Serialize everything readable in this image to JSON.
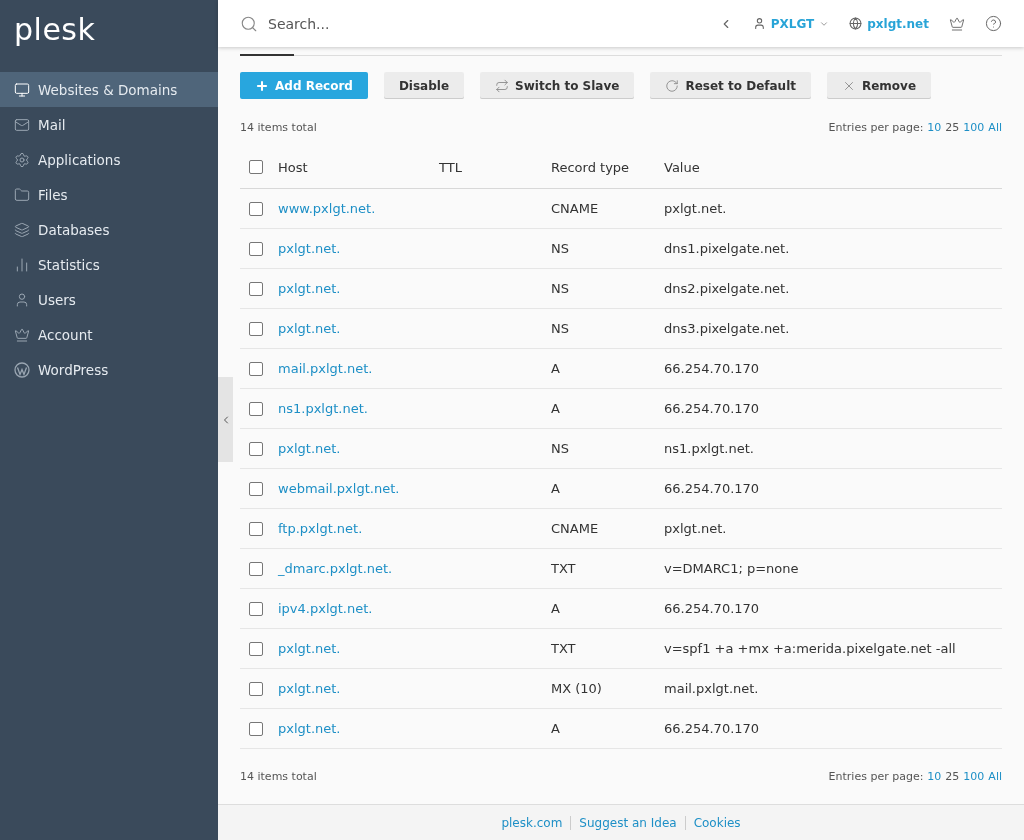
{
  "sidebar": {
    "logo": "plesk",
    "items": [
      {
        "label": "Websites & Domains",
        "selected": true
      },
      {
        "label": "Mail",
        "selected": false
      },
      {
        "label": "Applications",
        "selected": false
      },
      {
        "label": "Files",
        "selected": false
      },
      {
        "label": "Databases",
        "selected": false
      },
      {
        "label": "Statistics",
        "selected": false
      },
      {
        "label": "Users",
        "selected": false
      },
      {
        "label": "Account",
        "selected": false
      },
      {
        "label": "WordPress",
        "selected": false
      }
    ]
  },
  "topbar": {
    "search_placeholder": "Search...",
    "user": "PXLGT",
    "domain": "pxlgt.net"
  },
  "toolbar": [
    {
      "label": "Add Record",
      "kind": "primary"
    },
    {
      "label": "Disable",
      "kind": "plain"
    },
    {
      "label": "Switch to Slave",
      "kind": "plain"
    },
    {
      "label": "Reset to Default",
      "kind": "plain"
    },
    {
      "label": "Remove",
      "kind": "plain"
    }
  ],
  "summary_top": {
    "total": "14 items total",
    "entries_label": "Entries per page:",
    "options": [
      {
        "label": "10",
        "selected": false
      },
      {
        "label": "25",
        "selected": true
      },
      {
        "label": "100",
        "selected": false
      },
      {
        "label": "All",
        "selected": false
      }
    ]
  },
  "table": {
    "select_all_checked": false,
    "columns": [
      "Host",
      "TTL",
      "Record type",
      "Value"
    ],
    "rows": [
      {
        "host": "www.pxlgt.net.",
        "ttl": "",
        "type": "CNAME",
        "value": "pxlgt.net.",
        "checked": false
      },
      {
        "host": "pxlgt.net.",
        "ttl": "",
        "type": "NS",
        "value": "dns1.pixelgate.net.",
        "checked": false
      },
      {
        "host": "pxlgt.net.",
        "ttl": "",
        "type": "NS",
        "value": "dns2.pixelgate.net.",
        "checked": false
      },
      {
        "host": "pxlgt.net.",
        "ttl": "",
        "type": "NS",
        "value": "dns3.pixelgate.net.",
        "checked": false
      },
      {
        "host": "mail.pxlgt.net.",
        "ttl": "",
        "type": "A",
        "value": "66.254.70.170",
        "checked": false
      },
      {
        "host": "ns1.pxlgt.net.",
        "ttl": "",
        "type": "A",
        "value": "66.254.70.170",
        "checked": false
      },
      {
        "host": "pxlgt.net.",
        "ttl": "",
        "type": "NS",
        "value": "ns1.pxlgt.net.",
        "checked": false
      },
      {
        "host": "webmail.pxlgt.net.",
        "ttl": "",
        "type": "A",
        "value": "66.254.70.170",
        "checked": false
      },
      {
        "host": "ftp.pxlgt.net.",
        "ttl": "",
        "type": "CNAME",
        "value": "pxlgt.net.",
        "checked": false
      },
      {
        "host": "_dmarc.pxlgt.net.",
        "ttl": "",
        "type": "TXT",
        "value": "v=DMARC1; p=none",
        "checked": false
      },
      {
        "host": "ipv4.pxlgt.net.",
        "ttl": "",
        "type": "A",
        "value": "66.254.70.170",
        "checked": false
      },
      {
        "host": "pxlgt.net.",
        "ttl": "",
        "type": "TXT",
        "value": "v=spf1 +a +mx +a:merida.pixelgate.net -all",
        "checked": false
      },
      {
        "host": "pxlgt.net.",
        "ttl": "",
        "type": "MX (10)",
        "value": "mail.pxlgt.net.",
        "checked": false
      },
      {
        "host": "pxlgt.net.",
        "ttl": "",
        "type": "A",
        "value": "66.254.70.170",
        "checked": false
      }
    ]
  },
  "summary_bottom": {
    "total": "14 items total",
    "entries_label": "Entries per page:",
    "options": [
      {
        "label": "10",
        "selected": false
      },
      {
        "label": "25",
        "selected": true
      },
      {
        "label": "100",
        "selected": false
      },
      {
        "label": "All",
        "selected": false
      }
    ]
  },
  "footer": {
    "links": [
      "plesk.com",
      "Suggest an Idea",
      "Cookies"
    ]
  }
}
